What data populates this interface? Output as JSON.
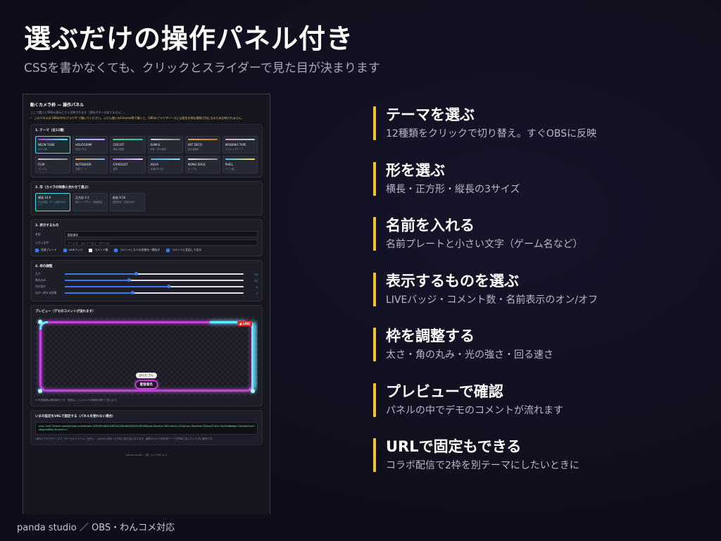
{
  "slide": {
    "title": "選ぶだけの操作パネル付き",
    "subtitle": "CSSを書かなくても、クリックとスライダーで見た目が決まります",
    "footer": "panda studio ／ OBS・わんコメ対応"
  },
  "panel": {
    "title": "動くカメラ枠 — 操作パネル",
    "desc": "ここで選ぶとOBSの表示にすぐ反映されます（保存ボタンはありません）。",
    "warn": "！ このパネルは OBSの中のブラウザ で開いてください。ふだん使いのChrome等で開くと、OBSのブラウザソースとは設定の保存場所が別になるため反映されません。",
    "theme_section": "1. テーマ（全12種）",
    "themes": [
      {
        "name": "NEON TUBE",
        "sub": "ネオン管",
        "color": "#c040d8",
        "color2": "#5ff0ff"
      },
      {
        "name": "HOLOGRAM",
        "sub": "虹色に光る",
        "color": "#8ab4ff",
        "color2": "#e0a0ff"
      },
      {
        "name": "CIRCUIT",
        "sub": "基板の回路",
        "color": "#30e080",
        "color2": "#30c0a0"
      },
      {
        "name": "SUMI-E",
        "sub": "和風・墨の筆致",
        "color": "#d8d8d8",
        "color2": "#888888"
      },
      {
        "name": "ART DECO",
        "sub": "金の装飾枠",
        "color": "#e0b040",
        "color2": "#c08820"
      },
      {
        "name": "MASKING TAPE",
        "sub": "マスキングテープ",
        "color": "#f0a0c0",
        "color2": "#a0d0f0"
      },
      {
        "name": "FILM",
        "sub": "フィルム",
        "color": "#d0d0d0",
        "color2": "#909090"
      },
      {
        "name": "NOTEBOOK",
        "sub": "方眼ノート",
        "color": "#f0a040",
        "color2": "#80b0f0"
      },
      {
        "name": "STARDUST",
        "sub": "星屑",
        "color": "#9a80ff",
        "color2": "#f0d0ff"
      },
      {
        "name": "AQUA",
        "sub": "水面のゆらぎ",
        "color": "#40b8f0",
        "color2": "#80e0ff"
      },
      {
        "name": "MONO EDGE",
        "sub": "モノクロ",
        "color": "#f0f0f0",
        "color2": "#909090"
      },
      {
        "name": "PIXEL",
        "sub": "ドット絵",
        "color": "#40d0f0",
        "color2": "#f0e040"
      }
    ],
    "shape_section": "2. 形（カメラの映像に合わせて選ぶ）",
    "shapes": [
      {
        "name": "横長 16:9",
        "sub": "PCの配信・ゲーム実況のタイプ"
      },
      {
        "name": "正方形 1:1",
        "sub": "縦のレイアウト・雑談配信"
      },
      {
        "name": "縦長 9:16",
        "sub": "縦型配信・全身を映す"
      }
    ],
    "display_section": "3. 表示するもの",
    "name_label": "名前",
    "name_value": "配信者名",
    "small_label": "小さい文字",
    "small_placeholder": "ゲーム名・あいさつなど（空でOK）",
    "checks": [
      {
        "label": "名前プレート",
        "on": true
      },
      {
        "label": "LIVEバッジ",
        "on": true
      },
      {
        "label": "コメント数",
        "on": false
      },
      {
        "label": "コメントした人の名前を一瞬出す",
        "on": true
      },
      {
        "label": "コメントに反応して光る",
        "on": true
      }
    ],
    "frame_section": "4. 枠の調整",
    "sliders": [
      {
        "label": "太さ",
        "value": "10",
        "level": 0.4
      },
      {
        "label": "角の丸み",
        "value": "22",
        "level": 0.36
      },
      {
        "label": "光の強さ",
        "value": "1",
        "level": 0.58
      },
      {
        "label": "光が一周する秒数",
        "value": "7",
        "level": 0.38
      }
    ],
    "preview_section": "プレビュー（デモのコメントが流れます）",
    "live": "● LIVE",
    "chip_text": "ぱんだ さん",
    "plate_text": "配信者名",
    "preview_note": "※ 市松模様は透明部分です。実際はここにカメラの映像が透けて見えます。",
    "url_section": "いまの設定をURLで固定する（パネルを使わない場合）",
    "url_value": "view.html?theme=neon&shape=wide&name=%E9%85%8D%E4%BF%A1%E8%80%85%E5%90%8D&sub=&width=10&radius=22&glow=1&speed=7&showFlate=1&showBadge=1&showCount=0&showWho=1&react=1",
    "url_note": "OBSのブラウザソースで「ローカルファイル」を外し、上のURLを貼っても同じ見た目になります。複数のカメラ枠を別テーマで同時に出したいときに便利です。",
    "foot": "panda studio — 動くカメラ枠 v1.0"
  },
  "features": [
    {
      "title": "テーマを選ぶ",
      "desc": "12種類をクリックで切り替え。すぐOBSに反映"
    },
    {
      "title": "形を選ぶ",
      "desc": "横長・正方形・縦長の3サイズ"
    },
    {
      "title": "名前を入れる",
      "desc": "名前プレートと小さい文字（ゲーム名など）"
    },
    {
      "title": "表示するものを選ぶ",
      "desc": "LIVEバッジ・コメント数・名前表示のオン/オフ"
    },
    {
      "title": "枠を調整する",
      "desc": "太さ・角の丸み・光の強さ・回る速さ"
    },
    {
      "title": "プレビューで確認",
      "desc": "パネルの中でデモのコメントが流れます"
    },
    {
      "title": "URLで固定もできる",
      "desc": "コラボ配信で2枠を別テーマにしたいときに"
    }
  ]
}
